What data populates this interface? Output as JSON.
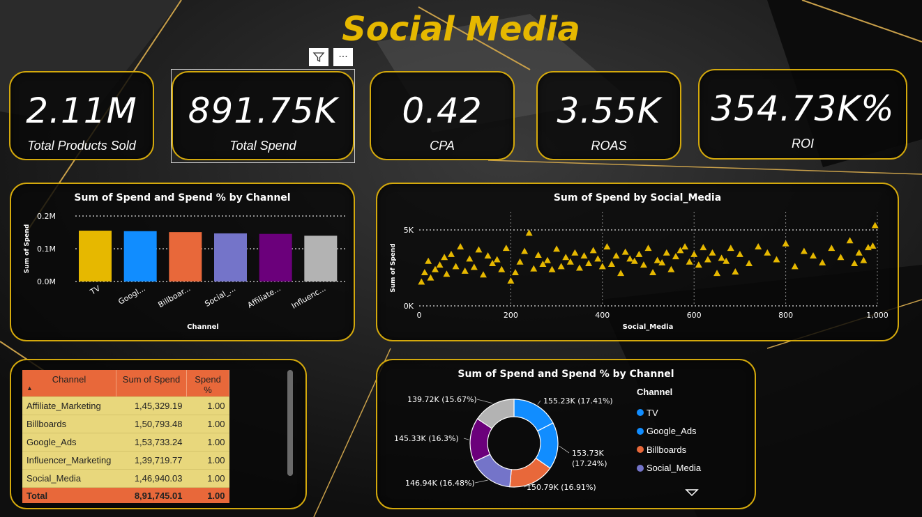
{
  "title": "Social Media",
  "kpis": [
    {
      "value": "2.11M",
      "label": "Total Products Sold"
    },
    {
      "value": "891.75K",
      "label": "Total Spend"
    },
    {
      "value": "0.42",
      "label": "CPA"
    },
    {
      "value": "3.55K",
      "label": "ROAS"
    },
    {
      "value": "354.73K%",
      "label": "ROI"
    }
  ],
  "visual_header": {
    "filter_icon": "filter-icon",
    "more_label": "···"
  },
  "colors": {
    "accent": "#e6b800",
    "border": "#d4a90c",
    "table_header": "#e8683a",
    "table_row": "#e8d77c"
  },
  "chart_data": [
    {
      "type": "bar",
      "title": "Sum of Spend and Spend % by Channel",
      "xlabel": "Channel",
      "ylabel": "Sum of Spend",
      "categories": [
        "TV",
        "Google_Ads",
        "Billboards",
        "Social_Media",
        "Affiliate_Marketing",
        "Influencer_Marketing"
      ],
      "tick_labels": [
        "TV",
        "Googl...",
        "Billboar...",
        "Social_...",
        "Affiliate...",
        "Influenc..."
      ],
      "values": [
        155230,
        153733,
        150793,
        146940,
        145329,
        139720
      ],
      "colors": [
        "#e6b800",
        "#118dff",
        "#e8683a",
        "#7474c9",
        "#6b007b",
        "#b3b3b3"
      ],
      "yticks": [
        "0.0M",
        "0.1M",
        "0.2M"
      ],
      "ylim": [
        0,
        200000
      ],
      "grid": true
    },
    {
      "type": "scatter",
      "title": "Sum of Spend by Social_Media",
      "xlabel": "Social_Media",
      "ylabel": "Sum of Spend",
      "xlim": [
        0,
        1000
      ],
      "ylim": [
        0,
        5000
      ],
      "xticks": [
        "0",
        "200",
        "400",
        "600",
        "800",
        "1,000"
      ],
      "yticks": [
        "0K",
        "5K"
      ],
      "marker": "triangle",
      "color": "#e6b800",
      "points": [
        [
          5,
          1580
        ],
        [
          12,
          2200
        ],
        [
          20,
          2950
        ],
        [
          25,
          1850
        ],
        [
          35,
          2400
        ],
        [
          45,
          2700
        ],
        [
          55,
          3200
        ],
        [
          60,
          2100
        ],
        [
          70,
          3400
        ],
        [
          80,
          2600
        ],
        [
          90,
          3900
        ],
        [
          100,
          2300
        ],
        [
          110,
          3100
        ],
        [
          120,
          2550
        ],
        [
          130,
          3700
        ],
        [
          140,
          2050
        ],
        [
          150,
          3300
        ],
        [
          160,
          2800
        ],
        [
          170,
          3050
        ],
        [
          180,
          2400
        ],
        [
          190,
          3800
        ],
        [
          200,
          1650
        ],
        [
          210,
          2200
        ],
        [
          220,
          2900
        ],
        [
          230,
          3600
        ],
        [
          240,
          4800
        ],
        [
          250,
          2450
        ],
        [
          260,
          3350
        ],
        [
          270,
          2750
        ],
        [
          280,
          3000
        ],
        [
          290,
          2400
        ],
        [
          300,
          3750
        ],
        [
          310,
          2600
        ],
        [
          320,
          3200
        ],
        [
          330,
          2900
        ],
        [
          340,
          3500
        ],
        [
          350,
          2500
        ],
        [
          360,
          3300
        ],
        [
          370,
          2800
        ],
        [
          380,
          3650
        ],
        [
          390,
          3100
        ],
        [
          400,
          2600
        ],
        [
          410,
          3900
        ],
        [
          420,
          2750
        ],
        [
          430,
          3300
        ],
        [
          440,
          2150
        ],
        [
          450,
          3550
        ],
        [
          460,
          3100
        ],
        [
          470,
          2950
        ],
        [
          480,
          3400
        ],
        [
          490,
          2700
        ],
        [
          500,
          3800
        ],
        [
          510,
          2200
        ],
        [
          520,
          3000
        ],
        [
          530,
          2850
        ],
        [
          540,
          3500
        ],
        [
          550,
          2400
        ],
        [
          560,
          3250
        ],
        [
          570,
          3650
        ],
        [
          580,
          3900
        ],
        [
          590,
          2900
        ],
        [
          600,
          3400
        ],
        [
          610,
          2700
        ],
        [
          620,
          3850
        ],
        [
          630,
          3050
        ],
        [
          640,
          3500
        ],
        [
          650,
          2150
        ],
        [
          660,
          3150
        ],
        [
          670,
          2950
        ],
        [
          680,
          3800
        ],
        [
          690,
          2250
        ],
        [
          700,
          3400
        ],
        [
          720,
          2800
        ],
        [
          740,
          3900
        ],
        [
          760,
          3500
        ],
        [
          780,
          3050
        ],
        [
          800,
          4100
        ],
        [
          820,
          2600
        ],
        [
          840,
          3600
        ],
        [
          860,
          3300
        ],
        [
          880,
          2850
        ],
        [
          900,
          3800
        ],
        [
          920,
          3200
        ],
        [
          940,
          4300
        ],
        [
          960,
          3500
        ],
        [
          980,
          3850
        ],
        [
          995,
          5300
        ],
        [
          990,
          3950
        ],
        [
          970,
          3000
        ],
        [
          950,
          2800
        ]
      ]
    },
    {
      "type": "pie",
      "title": "Sum of Spend and Spend % by Channel",
      "legend_title": "Channel",
      "legend_items": [
        "TV",
        "Google_Ads",
        "Billboards",
        "Social_Media"
      ],
      "slices": [
        {
          "label": "TV",
          "value": 155230,
          "text": "155.23K (17.41%)",
          "color": "#118dff"
        },
        {
          "label": "Google_Ads",
          "value": 153730,
          "text": "153.73K (17.24%)",
          "color": "#118dff"
        },
        {
          "label": "Billboards",
          "value": 150790,
          "text": "150.79K (16.91%)",
          "color": "#e8683a"
        },
        {
          "label": "Social_Media",
          "value": 146940,
          "text": "146.94K (16.48%)",
          "color": "#7474c9"
        },
        {
          "label": "Affiliate_Marketing",
          "value": 145330,
          "text": "145.33K (16.3%)",
          "color": "#6b007b"
        },
        {
          "label": "Influencer_Marketing",
          "value": 139720,
          "text": "139.72K (15.67%)",
          "color": "#b3b3b3"
        }
      ],
      "legend_colors": [
        "#118dff",
        "#118dff",
        "#e8683a",
        "#7474c9"
      ]
    },
    {
      "type": "table",
      "headers": [
        "Channel",
        "Sum of Spend",
        "Spend %"
      ],
      "rows": [
        [
          "Affiliate_Marketing",
          "1,45,329.19",
          "1.00"
        ],
        [
          "Billboards",
          "1,50,793.48",
          "1.00"
        ],
        [
          "Google_Ads",
          "1,53,733.24",
          "1.00"
        ],
        [
          "Influencer_Marketing",
          "1,39,719.77",
          "1.00"
        ],
        [
          "Social_Media",
          "1,46,940.03",
          "1.00"
        ]
      ],
      "total": [
        "Total",
        "8,91,745.01",
        "1.00"
      ],
      "sort_indicator": "▲"
    }
  ]
}
